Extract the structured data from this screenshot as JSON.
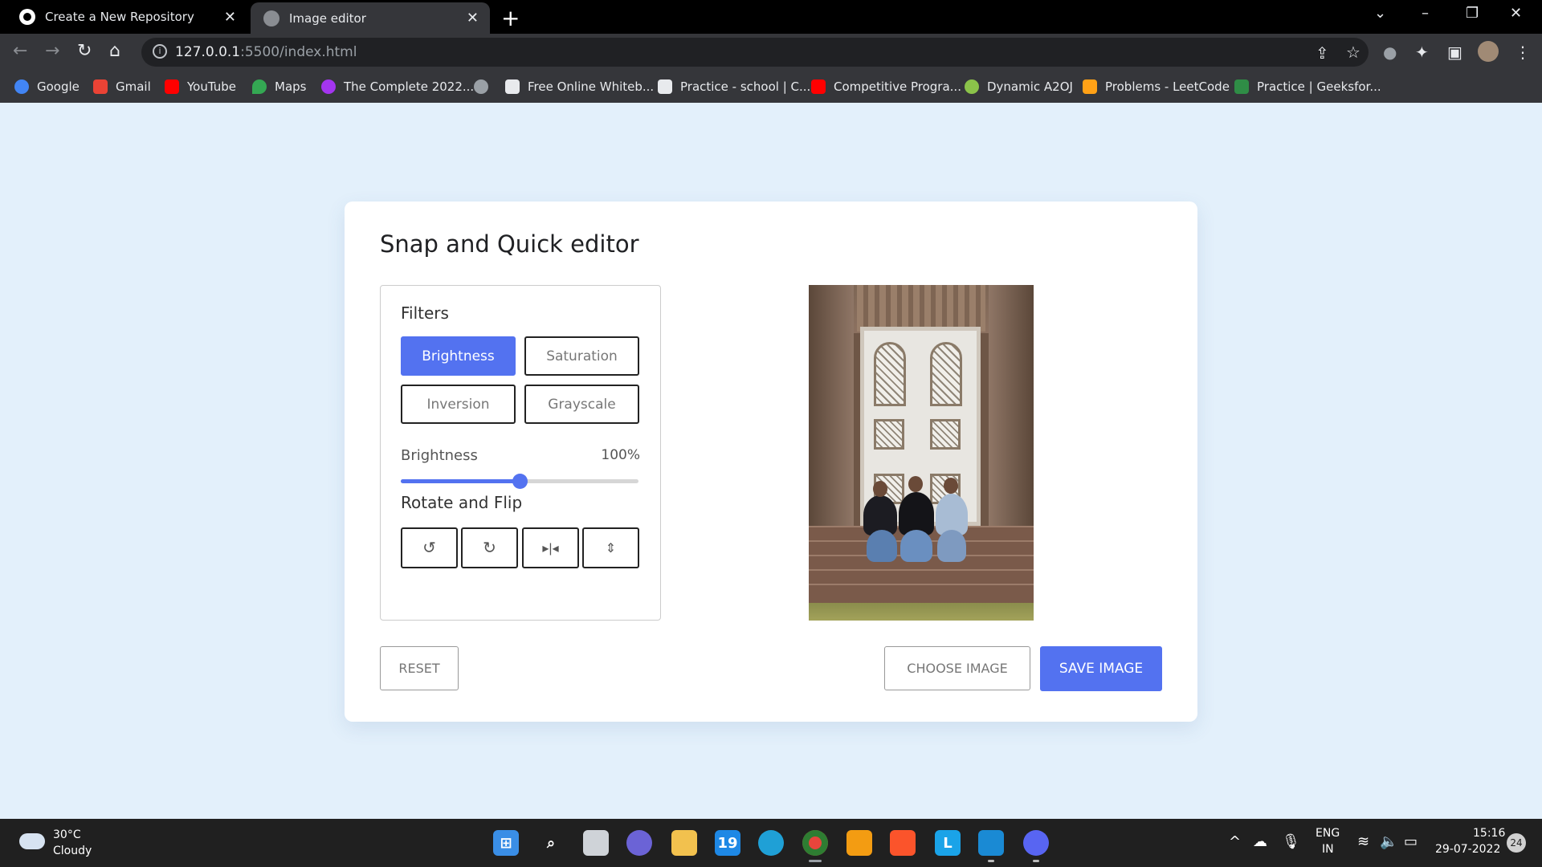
{
  "browser": {
    "tabs": [
      {
        "title": "Create a New Repository",
        "icon": "github-icon"
      },
      {
        "title": "Image editor",
        "icon": "globe-icon",
        "active": true
      }
    ],
    "url_host": "127.0.0.1",
    "url_path": ":5500/index.html",
    "bookmarks": [
      {
        "label": "Google",
        "icon": "google-icon",
        "color": "#4285f4"
      },
      {
        "label": "Gmail",
        "icon": "gmail-icon",
        "color": "#ea4335"
      },
      {
        "label": "YouTube",
        "icon": "youtube-icon",
        "color": "#ff0000"
      },
      {
        "label": "Maps",
        "icon": "maps-icon",
        "color": "#34a853"
      },
      {
        "label": "The Complete 2022...",
        "icon": "udemy-icon",
        "color": "#a435f0"
      },
      {
        "label": "",
        "icon": "globe-icon",
        "color": "#9aa0a6"
      },
      {
        "label": "Free Online Whiteb...",
        "icon": "whiteboard-icon",
        "color": "#e8eaed"
      },
      {
        "label": "Practice - school | C...",
        "icon": "cc-icon",
        "color": "#e8eaed"
      },
      {
        "label": "Competitive Progra...",
        "icon": "youtube-icon",
        "color": "#ff0000"
      },
      {
        "label": "Dynamic A2OJ",
        "icon": "a2oj-icon",
        "color": "#8bc34a"
      },
      {
        "label": "Problems - LeetCode",
        "icon": "leetcode-icon",
        "color": "#ffa116"
      },
      {
        "label": "Practice | Geeksfor...",
        "icon": "gfg-icon",
        "color": "#2f8d46"
      }
    ]
  },
  "editor": {
    "title": "Snap and Quick editor",
    "filters_title": "Filters",
    "filters": [
      "Brightness",
      "Saturation",
      "Inversion",
      "Grayscale"
    ],
    "active_filter": "Brightness",
    "slider_label": "Brightness",
    "slider_value_text": "100%",
    "slider_fraction": 0.5,
    "rotate_title": "Rotate and Flip",
    "rotate_buttons": [
      "rotate-left-icon",
      "rotate-right-icon",
      "flip-horizontal-icon",
      "flip-vertical-icon"
    ],
    "reset_label": "RESET",
    "choose_label": "CHOOSE IMAGE",
    "save_label": "SAVE IMAGE",
    "accent": "#5372f0"
  },
  "taskbar": {
    "weather_temp": "30°C",
    "weather_desc": "Cloudy",
    "lang_line1": "ENG",
    "lang_line2": "IN",
    "time": "15:16",
    "date": "29-07-2022",
    "notification_count": "24",
    "apps": [
      "start-icon",
      "search-icon",
      "task-view-icon",
      "chat-icon",
      "file-explorer-icon",
      "calendar-icon",
      "edge-icon",
      "chrome-icon",
      "sublime-icon",
      "brave-icon",
      "l-app-icon",
      "vscode-icon",
      "discord-icon"
    ],
    "calendar_day": "19"
  }
}
